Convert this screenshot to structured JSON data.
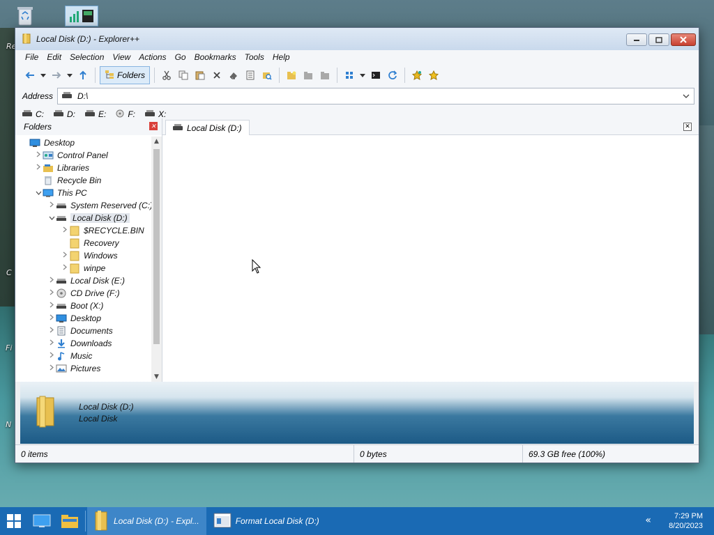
{
  "desktop": {
    "icons": [
      {
        "name": "recycle-bin-icon",
        "label": "Re"
      },
      {
        "name": "app-icon",
        "label": ""
      }
    ],
    "side_labels": [
      "C",
      "Fi",
      "N"
    ]
  },
  "window": {
    "title": "Local Disk (D:) - Explorer++",
    "menu": [
      "File",
      "Edit",
      "Selection",
      "View",
      "Actions",
      "Go",
      "Bookmarks",
      "Tools",
      "Help"
    ],
    "toolbar": {
      "folders_label": "Folders"
    },
    "address": {
      "label": "Address",
      "value": "D:\\"
    },
    "drives": [
      "C:",
      "D:",
      "E:",
      "F:",
      "X:"
    ],
    "folders_pane": {
      "title": "Folders",
      "tree": [
        {
          "level": 0,
          "label": "Desktop",
          "icon": "desktop-icon",
          "expander": ""
        },
        {
          "level": 1,
          "label": "Control Panel",
          "icon": "control-panel-icon",
          "expander": ">"
        },
        {
          "level": 1,
          "label": "Libraries",
          "icon": "libraries-icon",
          "expander": ">"
        },
        {
          "level": 1,
          "label": "Recycle Bin",
          "icon": "recycle-bin-icon",
          "expander": ""
        },
        {
          "level": 1,
          "label": "This PC",
          "icon": "pc-icon",
          "expander": "v"
        },
        {
          "level": 2,
          "label": "System Reserved (C:)",
          "icon": "drive-icon",
          "expander": ">"
        },
        {
          "level": 2,
          "label": "Local Disk (D:)",
          "icon": "drive-icon",
          "expander": "v",
          "selected": true
        },
        {
          "level": 3,
          "label": "$RECYCLE.BIN",
          "icon": "folder-icon",
          "expander": ">"
        },
        {
          "level": 3,
          "label": "Recovery",
          "icon": "folder-icon",
          "expander": ""
        },
        {
          "level": 3,
          "label": "Windows",
          "icon": "folder-icon",
          "expander": ">"
        },
        {
          "level": 3,
          "label": "winpe",
          "icon": "folder-icon",
          "expander": ">"
        },
        {
          "level": 2,
          "label": "Local Disk (E:)",
          "icon": "drive-icon",
          "expander": ">"
        },
        {
          "level": 2,
          "label": "CD Drive (F:)",
          "icon": "cd-icon",
          "expander": ">"
        },
        {
          "level": 2,
          "label": "Boot (X:)",
          "icon": "drive-icon",
          "expander": ">"
        },
        {
          "level": 2,
          "label": "Desktop",
          "icon": "desktop-icon",
          "expander": ">"
        },
        {
          "level": 2,
          "label": "Documents",
          "icon": "documents-icon",
          "expander": ">"
        },
        {
          "level": 2,
          "label": "Downloads",
          "icon": "downloads-icon",
          "expander": ">"
        },
        {
          "level": 2,
          "label": "Music",
          "icon": "music-icon",
          "expander": ">"
        },
        {
          "level": 2,
          "label": "Pictures",
          "icon": "pictures-icon",
          "expander": ">"
        }
      ]
    },
    "tab": {
      "label": "Local Disk (D:)"
    },
    "info": {
      "line1": "Local Disk (D:)",
      "line2": "Local Disk"
    },
    "status": {
      "items": "0 items",
      "size": "0 bytes",
      "free": "69.3 GB free (100%)"
    }
  },
  "taskbar": {
    "apps": [
      {
        "label": "Local Disk (D:) - Expl...",
        "icon": "folder-icon",
        "active": true
      },
      {
        "label": "Format Local Disk (D:)",
        "icon": "format-icon",
        "active": false
      }
    ],
    "time": "7:29 PM",
    "date": "8/20/2023"
  },
  "colors": {
    "taskbar": "#1a6ab4",
    "accent": "#3e86c8",
    "close": "#d9403a"
  }
}
